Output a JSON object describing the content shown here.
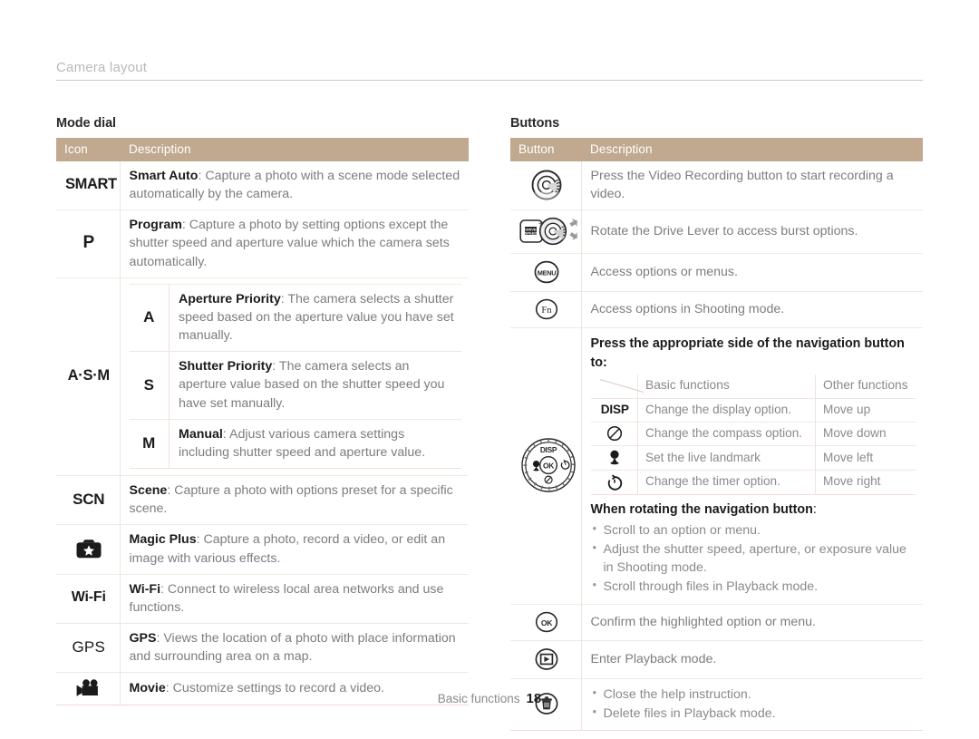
{
  "running_head": "Camera layout",
  "mode_dial": {
    "title": "Mode dial",
    "columns": {
      "icon": "Icon",
      "description": "Description"
    },
    "rows": [
      {
        "icon": "SMART",
        "icon_kind": "text",
        "term": "Smart Auto",
        "desc": ": Capture a photo with a scene mode selected automatically by the camera."
      },
      {
        "icon": "P",
        "icon_kind": "text",
        "term": "Program",
        "desc": ": Capture a photo by setting options except the shutter speed and aperture value which the camera sets automatically."
      },
      {
        "icon": "A·S·M",
        "icon_kind": "text",
        "nested": [
          {
            "icon": "A",
            "term": "Aperture Priority",
            "desc": ": The camera selects a shutter speed based on the aperture value you have set manually."
          },
          {
            "icon": "S",
            "term": "Shutter Priority",
            "desc": ": The camera selects an aperture value based on the shutter speed you have set manually."
          },
          {
            "icon": "M",
            "term": "Manual",
            "desc": ": Adjust various camera settings including shutter speed and aperture value."
          }
        ]
      },
      {
        "icon": "SCN",
        "icon_kind": "text",
        "term": "Scene",
        "desc": ": Capture a photo with options preset for a specific scene."
      },
      {
        "icon": "magic-plus-icon",
        "icon_kind": "glyph",
        "term": "Magic Plus",
        "desc": ": Capture a photo, record a video, or edit an image with various effects."
      },
      {
        "icon": "Wi-Fi",
        "icon_kind": "text",
        "term": "Wi-Fi",
        "desc": ": Connect to wireless local area networks and use functions."
      },
      {
        "icon": "GPS",
        "icon_kind": "text",
        "term": "GPS",
        "desc": ": Views the location of a photo with place information and surrounding area on a map."
      },
      {
        "icon": "movie-camera-icon",
        "icon_kind": "glyph",
        "term": "Movie",
        "desc": ": Customize settings to record a video."
      }
    ]
  },
  "buttons": {
    "title": "Buttons",
    "columns": {
      "button": "Button",
      "description": "Description"
    },
    "rows": [
      {
        "icon": "video-recording-button-icon",
        "desc": "Press the Video Recording button to start recording a video."
      },
      {
        "icon": "drive-lever-icon",
        "desc": "Rotate the Drive Lever to access burst options."
      },
      {
        "icon": "menu-button-icon",
        "desc": "Access options or menus."
      },
      {
        "icon": "fn-button-icon",
        "desc": "Access options in Shooting mode."
      },
      {
        "icon": "ok-button-icon",
        "desc": "Confirm the highlighted option or menu."
      },
      {
        "icon": "playback-button-icon",
        "desc": "Enter Playback mode."
      },
      {
        "icon": "delete-button-icon",
        "bullets": [
          "Close the help instruction.",
          "Delete files in Playback mode."
        ]
      }
    ],
    "navigation": {
      "icon": "navigation-dial-icon",
      "press_heading": "Press the appropriate side of the navigation button to:",
      "subtable": {
        "headers": {
          "key": "",
          "basic": "Basic functions",
          "other": "Other functions"
        },
        "rows": [
          {
            "key": "DISP",
            "key_kind": "text",
            "basic": "Change the display option.",
            "other": "Move up"
          },
          {
            "key": "compass-icon",
            "key_kind": "glyph",
            "basic": "Change the compass option.",
            "other": "Move down"
          },
          {
            "key": "landmark-icon",
            "key_kind": "glyph",
            "basic": "Set the live landmark",
            "other": "Move left"
          },
          {
            "key": "timer-icon",
            "key_kind": "glyph",
            "basic": "Change the timer option.",
            "other": "Move right"
          }
        ]
      },
      "rotate_heading": "When rotating the navigation button",
      "rotate_heading_colon": ":",
      "rotate_bullets": [
        "Scroll to an option or menu.",
        "Adjust the shutter speed, aperture, or exposure value in Shooting mode.",
        "Scroll through files in Playback mode."
      ]
    }
  },
  "footer": {
    "section": "Basic functions",
    "page": "18"
  },
  "colors": {
    "header_bg": "#c0a98f",
    "header_text": "#ffffff",
    "body_text": "#7d7d80",
    "term_text": "#1b1b1b",
    "rule": "#c8c8cd"
  }
}
